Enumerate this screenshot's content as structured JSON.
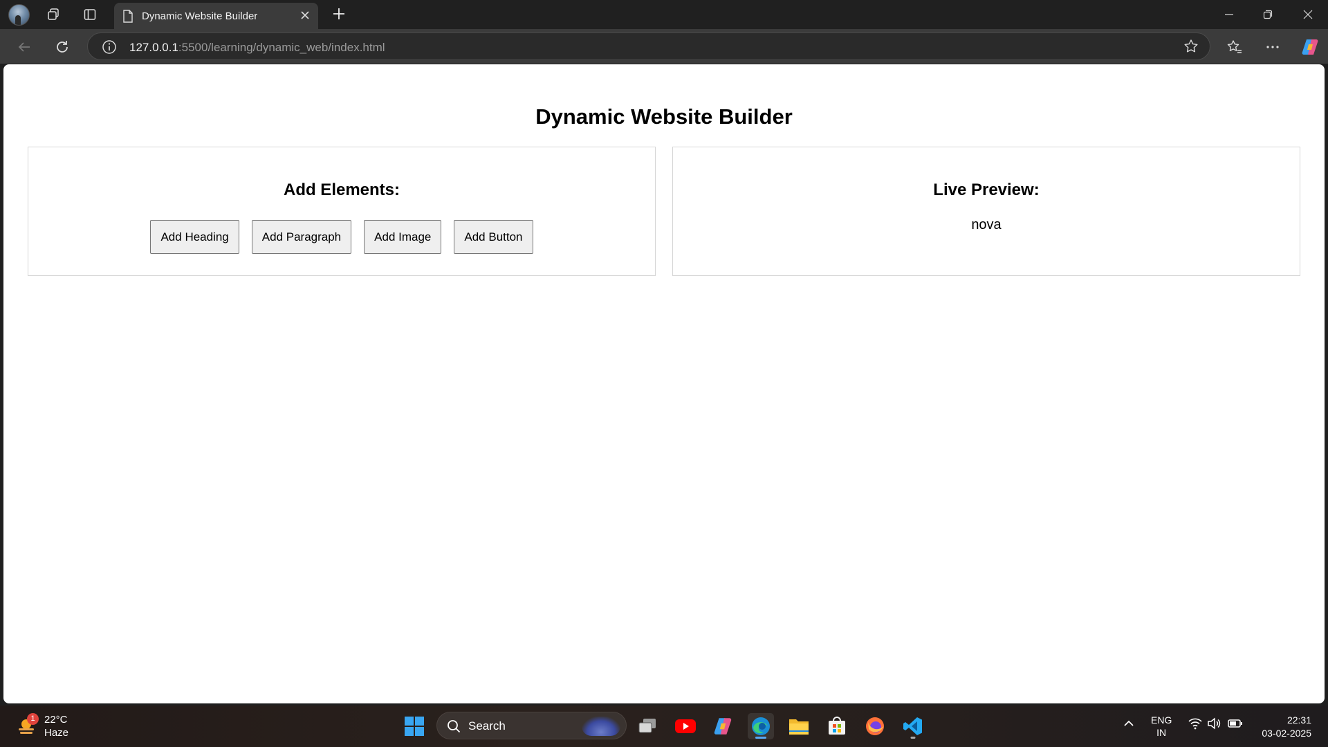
{
  "browser": {
    "tab_title": "Dynamic Website Builder",
    "url_host": "127.0.0.1",
    "url_rest": ":5500/learning/dynamic_web/index.html"
  },
  "page": {
    "title": "Dynamic Website Builder",
    "add_panel": {
      "heading": "Add Elements:",
      "buttons": [
        "Add Heading",
        "Add Paragraph",
        "Add Image",
        "Add Button"
      ]
    },
    "preview_panel": {
      "heading": "Live Preview:",
      "content": "nova"
    }
  },
  "taskbar": {
    "weather": {
      "temp": "22°C",
      "condition": "Haze",
      "badge": "1"
    },
    "search_label": "Search",
    "apps": [
      "task-view",
      "youtube",
      "copilot",
      "edge",
      "file-explorer",
      "microsoft-store",
      "firefox",
      "vscode"
    ],
    "language": {
      "line1": "ENG",
      "line2": "IN"
    },
    "clock": {
      "time": "22:31",
      "date": "03-02-2025"
    }
  },
  "colors": {
    "accent": "#58a9f5",
    "chrome_dark": "#202020",
    "page_bg": "#ffffff"
  }
}
